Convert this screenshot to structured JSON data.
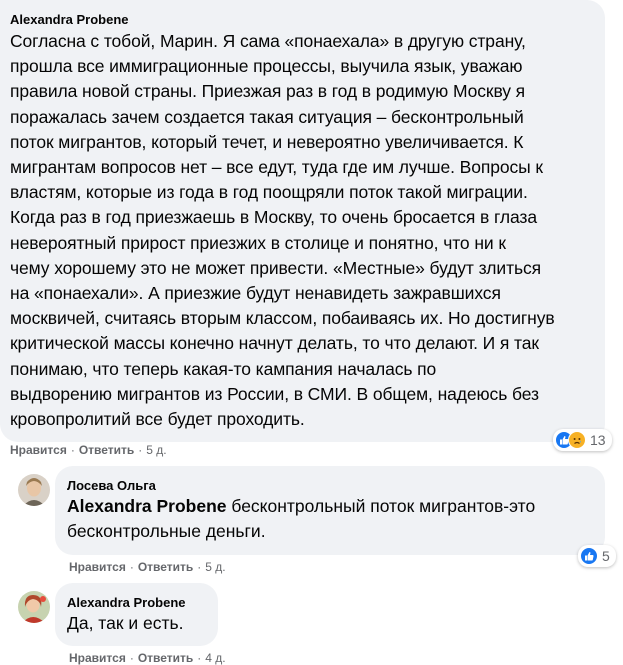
{
  "comments": [
    {
      "author": "Alexandra Probene",
      "text": "Согласна с тобой, Марин. Я сама «понаехала» в другую страну,\nпрошла все иммиграционные процессы, выучила язык, уважаю\nправила новой страны. Приезжая раз в год в родимую Москву я\nпоражалась зачем создается такая ситуация – бесконтрольный\nпоток мигрантов, который течет, и невероятно увеличивается. К\nмигрантам вопросов нет – все едут, туда где им лучше. Вопросы к\nвластям, которые из года в год поощряли поток такой миграции.\nКогда раз в год приезжаешь в Москву, то очень бросается в глаза\nневероятный прирост приезжих в столице и понятно, что ни к\nчему хорошему это не может привести. «Местные» будут злиться\nна «понаехали». А приезжие будут ненавидеть зажравшихся\nмосквичей, считаясь вторым классом, побаиваясь их. Но достигнув\nкритической массы конечно начнут делать, то что делают. И я так\nпонимаю, что теперь какая-то кампания началась по\nвыдворению мигрантов из России, в СМИ. В общем, надеюсь без\nкровопролитий все будет проходить.",
      "like_label": "Нравится",
      "reply_label": "Ответить",
      "time": "5 д.",
      "reaction_count": "13",
      "reactions": [
        "like-icon",
        "sad-icon"
      ]
    },
    {
      "author": "Лосева Ольга",
      "mention": "Alexandra Probene",
      "text": " бесконтрольный поток мигрантов-это\nбесконтрольные деньги.",
      "like_label": "Нравится",
      "reply_label": "Ответить",
      "time": "5 д.",
      "reaction_count": "5",
      "reactions": [
        "like-icon"
      ]
    },
    {
      "author": "Alexandra Probene",
      "text": "Да, так и есть.",
      "like_label": "Нравится",
      "reply_label": "Ответить",
      "time": "4 д."
    }
  ],
  "separator": "·",
  "colors": {
    "bubble": "#f0f2f5",
    "like": "#1877f2",
    "sad": "#f7b125",
    "secondary_text": "#65676b"
  }
}
